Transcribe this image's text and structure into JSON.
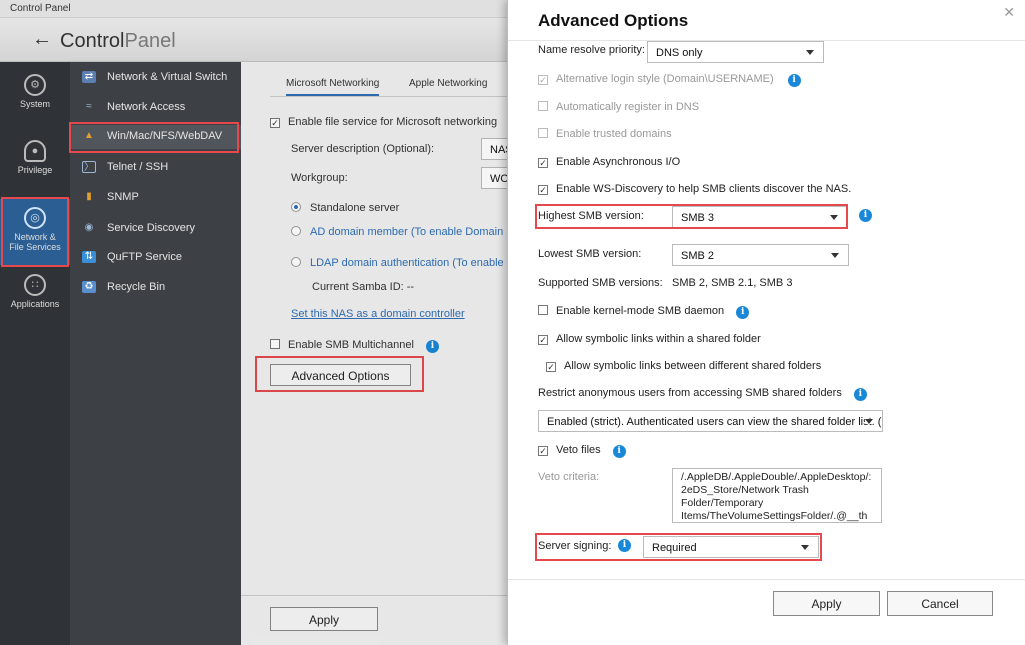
{
  "window": {
    "title": "Control Panel"
  },
  "header": {
    "back_icon": "arrow-left-icon",
    "title_main": "Control",
    "title_thin": "Panel"
  },
  "leftnav": {
    "items": [
      {
        "label": "System",
        "icon": "gear-icon"
      },
      {
        "label": "Privilege",
        "icon": "person-icon"
      },
      {
        "label": "Network &",
        "label2": "File Services",
        "icon": "globe-icon",
        "active": true
      },
      {
        "label": "Applications",
        "icon": "apps-icon"
      }
    ]
  },
  "subnav": {
    "items": [
      {
        "label": "Network & Virtual Switch",
        "icon": "network-switch-icon"
      },
      {
        "label": "Network Access",
        "icon": "network-access-icon"
      },
      {
        "label": "Win/Mac/NFS/WebDAV",
        "icon": "win-mac-icon",
        "active": true
      },
      {
        "label": "Telnet / SSH",
        "icon": "terminal-icon"
      },
      {
        "label": "SNMP",
        "icon": "snmp-icon"
      },
      {
        "label": "Service Discovery",
        "icon": "discovery-icon"
      },
      {
        "label": "QuFTP Service",
        "icon": "ftp-icon"
      },
      {
        "label": "Recycle Bin",
        "icon": "recycle-bin-icon"
      }
    ]
  },
  "main": {
    "tabs": [
      {
        "label": "Microsoft Networking"
      },
      {
        "label": "Apple Networking"
      }
    ],
    "enable_file_service": "Enable file service for Microsoft networking",
    "server_description_label": "Server description (Optional):",
    "server_description_value": "NAS",
    "workgroup_label": "Workgroup:",
    "workgroup_value": "WO",
    "radio_standalone": "Standalone server",
    "radio_ad": "AD domain member (To enable Domain Sec",
    "radio_ldap": "LDAP domain authentication (To enable Do",
    "samba_id": "Current Samba ID: --",
    "set_dc_link": "Set this NAS as a domain controller",
    "smb_multichannel": "Enable SMB Multichannel",
    "advanced_button": "Advanced Options",
    "apply_button": "Apply"
  },
  "dialog": {
    "title": "Advanced Options",
    "close_icon": "close-icon",
    "name_resolve_label": "Name resolve priority:",
    "name_resolve_value": "DNS only",
    "alt_login": "Alternative login style (Domain\\USERNAME)",
    "auto_register": "Automatically register in DNS",
    "trusted_domains": "Enable trusted domains",
    "async_io": "Enable Asynchronous I/O",
    "ws_discovery": "Enable WS-Discovery to help SMB clients discover the NAS.",
    "highest_smb_label": "Highest SMB version:",
    "highest_smb_value": "SMB 3",
    "lowest_smb_label": "Lowest SMB version:",
    "lowest_smb_value": "SMB 2",
    "supported_label": "Supported SMB versions:",
    "supported_value": "SMB 2, SMB 2.1, SMB 3",
    "kernel_mode": "Enable kernel-mode SMB daemon",
    "symlinks_within": "Allow symbolic links within a shared folder",
    "symlinks_between": "Allow symbolic links between different shared folders",
    "restrict_anon_label": "Restrict anonymous users from accessing SMB shared folders",
    "restrict_anon_value": "Enabled (strict). Authenticated users can view the shared folder list. (",
    "veto_files": "Veto files",
    "veto_criteria_label": "Veto criteria:",
    "veto_criteria_value": "/.AppleDB/.AppleDouble/.AppleDesktop/:2eDS_Store/Network Trash Folder/Temporary Items/TheVolumeSettingsFolder/.@__thu",
    "server_signing_label": "Server signing:",
    "server_signing_value": "Required",
    "apply_button": "Apply",
    "cancel_button": "Cancel"
  }
}
